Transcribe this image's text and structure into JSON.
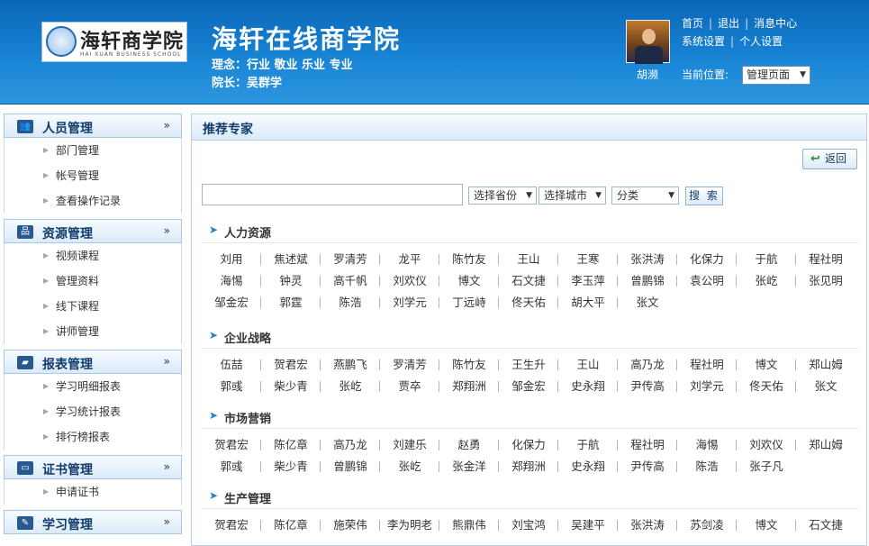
{
  "header": {
    "logo_cn": "海轩商学院",
    "logo_en": "HAI XUAN BUSINESS SCHOOL",
    "site_title": "海轩在线商学院",
    "motto": "理念：行业  敬业  乐业  专业",
    "president": "院长：吴群学",
    "username": "胡濒",
    "links": [
      "首页",
      "退出",
      "消息中心",
      "系统设置",
      "个人设置"
    ],
    "location_label": "当前位置:",
    "location_value": "管理页面"
  },
  "sidebar": {
    "sections": [
      {
        "title": "人员管理",
        "icon": "users-icon",
        "items": [
          "部门管理",
          "帐号管理",
          "查看操作记录"
        ]
      },
      {
        "title": "资源管理",
        "icon": "resource-icon",
        "items": [
          "视频课程",
          "管理资料",
          "线下课程",
          "讲师管理"
        ]
      },
      {
        "title": "报表管理",
        "icon": "folder-icon",
        "items": [
          "学习明细报表",
          "学习统计报表",
          "排行榜报表"
        ]
      },
      {
        "title": "证书管理",
        "icon": "certificate-icon",
        "items": [
          "申请证书"
        ]
      },
      {
        "title": "学习管理",
        "icon": "pen-icon",
        "items": []
      }
    ],
    "toggle": "»"
  },
  "main": {
    "title": "推荐专家",
    "back_label": "返回",
    "search_value": "",
    "province": "选择省份",
    "city": "选择城市",
    "category": "分类",
    "search_button": "搜 索",
    "categories": [
      {
        "name": "人力资源",
        "rows": [
          [
            "刘用",
            "焦述斌",
            "罗清芳",
            "龙平",
            "陈竹友",
            "王山",
            "王寒",
            "张洪涛",
            "化保力",
            "于航",
            "程社明"
          ],
          [
            "海惕",
            "钟灵",
            "高千帆",
            "刘欢仪",
            "博文",
            "石文捷",
            "李玉萍",
            "曾鹏锦",
            "袁公明",
            "张屹",
            "张见明"
          ],
          [
            "邹金宏",
            "郭霆",
            "陈浩",
            "刘学元",
            "丁远峙",
            "佟天佑",
            "胡大平",
            "张文"
          ]
        ]
      },
      {
        "name": "企业战略",
        "rows": [
          [
            "伍喆",
            "贺君宏",
            "燕鹏飞",
            "罗清芳",
            "陈竹友",
            "王生升",
            "王山",
            "高乃龙",
            "程社明",
            "博文",
            "郑山姆"
          ],
          [
            "郭彧",
            "柴少青",
            "张屹",
            "贾卒",
            "郑翔洲",
            "邹金宏",
            "史永翔",
            "尹传高",
            "刘学元",
            "佟天佑",
            "张文"
          ]
        ]
      },
      {
        "name": "市场营销",
        "rows": [
          [
            "贺君宏",
            "陈亿章",
            "高乃龙",
            "刘建乐",
            "赵勇",
            "化保力",
            "于航",
            "程社明",
            "海惕",
            "刘欢仪",
            "郑山姆"
          ],
          [
            "郭彧",
            "柴少青",
            "曾鹏锦",
            "张屹",
            "张金洋",
            "郑翔洲",
            "史永翔",
            "尹传高",
            "陈浩",
            "张子凡"
          ]
        ]
      },
      {
        "name": "生产管理",
        "rows": [
          [
            "贺君宏",
            "陈亿章",
            "施荣伟",
            "李为明老",
            "熊鼎伟",
            "刘宝鸿",
            "吴建平",
            "张洪涛",
            "苏剑凌",
            "博文",
            "石文捷"
          ]
        ]
      }
    ]
  }
}
